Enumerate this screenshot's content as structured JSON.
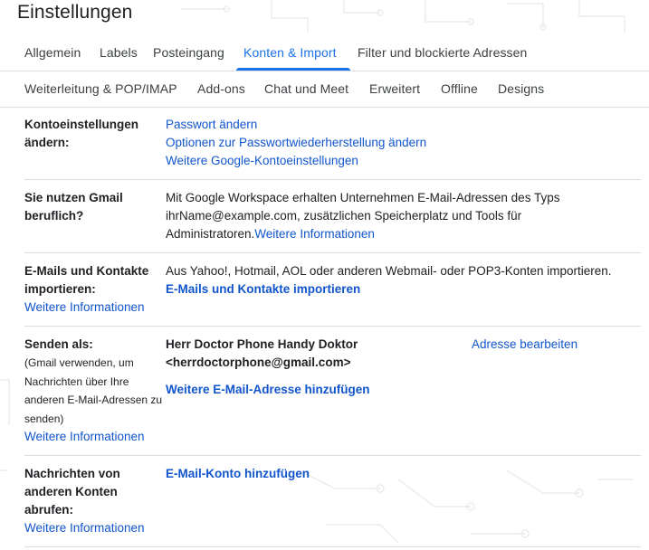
{
  "header": {
    "title": "Einstellungen"
  },
  "tabs_row1": [
    {
      "label": "Allgemein"
    },
    {
      "label": "Labels"
    },
    {
      "label": "Posteingang"
    },
    {
      "label": "Konten & Import",
      "active": true
    },
    {
      "label": "Filter und blockierte Adressen"
    }
  ],
  "tabs_row2": [
    {
      "label": "Weiterleitung & POP/IMAP"
    },
    {
      "label": "Add-ons"
    },
    {
      "label": "Chat und Meet"
    },
    {
      "label": "Erweitert"
    },
    {
      "label": "Offline"
    },
    {
      "label": "Designs"
    }
  ],
  "colors": {
    "accent": "#1a73e8",
    "link": "#1155cc",
    "divider": "#dadce0",
    "text": "#202124"
  },
  "sections": {
    "account": {
      "label_line1": "Kontoeinstellungen",
      "label_line2": "ändern:",
      "links": [
        "Passwort ändern",
        "Optionen zur Passwortwiederherstellung ändern",
        "Weitere Google-Kontoeinstellungen"
      ]
    },
    "workspace": {
      "label_line1": "Sie nutzen Gmail",
      "label_line2": "beruflich?",
      "text_line1": "Mit Google Workspace erhalten Unternehmen E-Mail-Adressen des Typs",
      "text_line2": "ihrName@example.com, zusätzlichen Speicherplatz und Tools für",
      "text_line3": "Administratoren.",
      "more_link": "Weitere Informationen"
    },
    "import": {
      "label_line1": "E-Mails und Kontakte",
      "label_line2": "importieren:",
      "more_link": "Weitere Informationen",
      "text": "Aus Yahoo!, Hotmail, AOL oder anderen Webmail- oder POP3-Konten importieren.",
      "action_link": "E-Mails und Kontakte importieren"
    },
    "send_as": {
      "label": "Senden als:",
      "sub_line1": "(Gmail verwenden, um",
      "sub_line2": "Nachrichten über Ihre",
      "sub_line3": "anderen E-Mail-Adressen zu",
      "sub_line4": "senden)",
      "more_link": "Weitere Informationen",
      "name": "Herr Doctor Phone Handy Doktor",
      "email": "<herrdoctorphone@gmail.com>",
      "edit_link": "Adresse bearbeiten",
      "add_link": "Weitere E-Mail-Adresse hinzufügen"
    },
    "fetch": {
      "label_line1": "Nachrichten von",
      "label_line2": "anderen Konten",
      "label_line3": "abrufen:",
      "more_link": "Weitere Informationen",
      "add_link": "E-Mail-Konto hinzufügen"
    }
  }
}
